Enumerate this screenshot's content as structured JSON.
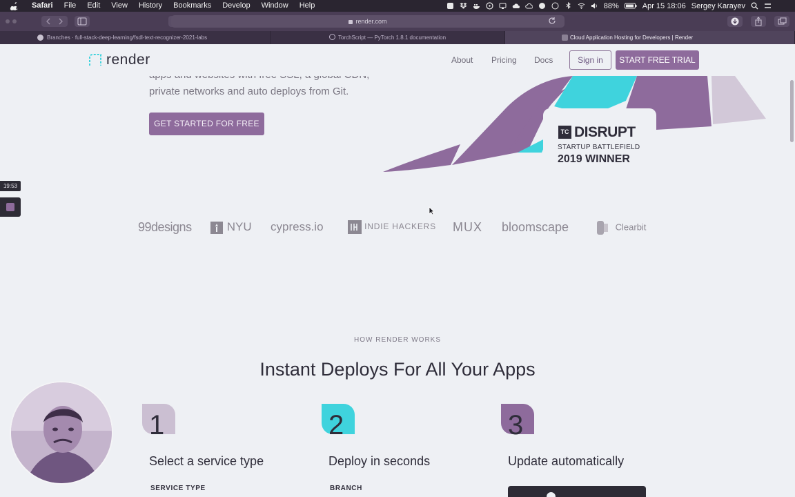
{
  "menubar": {
    "app": "Safari",
    "menus": [
      "File",
      "Edit",
      "View",
      "History",
      "Bookmarks",
      "Develop",
      "Window",
      "Help"
    ],
    "battery": "88%",
    "datetime": "Apr 15  18:06",
    "user": "Sergey Karayev"
  },
  "browser": {
    "url": "render.com",
    "tabs": [
      {
        "title": "Branches · full-stack-deep-learning/fsdl-text-recognizer-2021-labs",
        "active": false
      },
      {
        "title": "TorchScript — PyTorch 1.8.1 documentation",
        "active": false
      },
      {
        "title": "Cloud Application Hosting for Developers | Render",
        "active": true
      }
    ]
  },
  "site": {
    "logo_text": "render",
    "nav": {
      "about": "About",
      "pricing": "Pricing",
      "docs": "Docs",
      "signin": "Sign in",
      "trial": "START FREE TRIAL"
    },
    "hero": {
      "line1": "apps and websites with free SSL, a global CDN,",
      "line2": "private networks and auto deploys from Git.",
      "cta": "GET STARTED FOR FREE"
    },
    "award": {
      "badge": "TC",
      "title": "DISRUPT",
      "subtitle": "STARTUP BATTLEFIELD",
      "year": "2019 WINNER"
    },
    "customers": [
      "99designs",
      "NYU",
      "cypress.io",
      "INDIE HACKERS",
      "MUX",
      "bloomscape",
      "Clearbit"
    ],
    "how": {
      "label": "HOW RENDER WORKS",
      "title": "Instant Deploys For All Your Apps",
      "steps": [
        {
          "num": "1",
          "title": "Select a service type",
          "label": "SERVICE TYPE"
        },
        {
          "num": "2",
          "title": "Deploy in seconds",
          "label": "BRANCH"
        },
        {
          "num": "3",
          "title": "Update automatically",
          "label": ""
        }
      ]
    }
  },
  "overlay": {
    "timer": "19:53"
  },
  "colors": {
    "brand_purple": "#8e6b9c",
    "brand_cyan": "#3fd3dd",
    "text_dark": "#2f2d3a",
    "page_bg": "#eef0f4"
  }
}
